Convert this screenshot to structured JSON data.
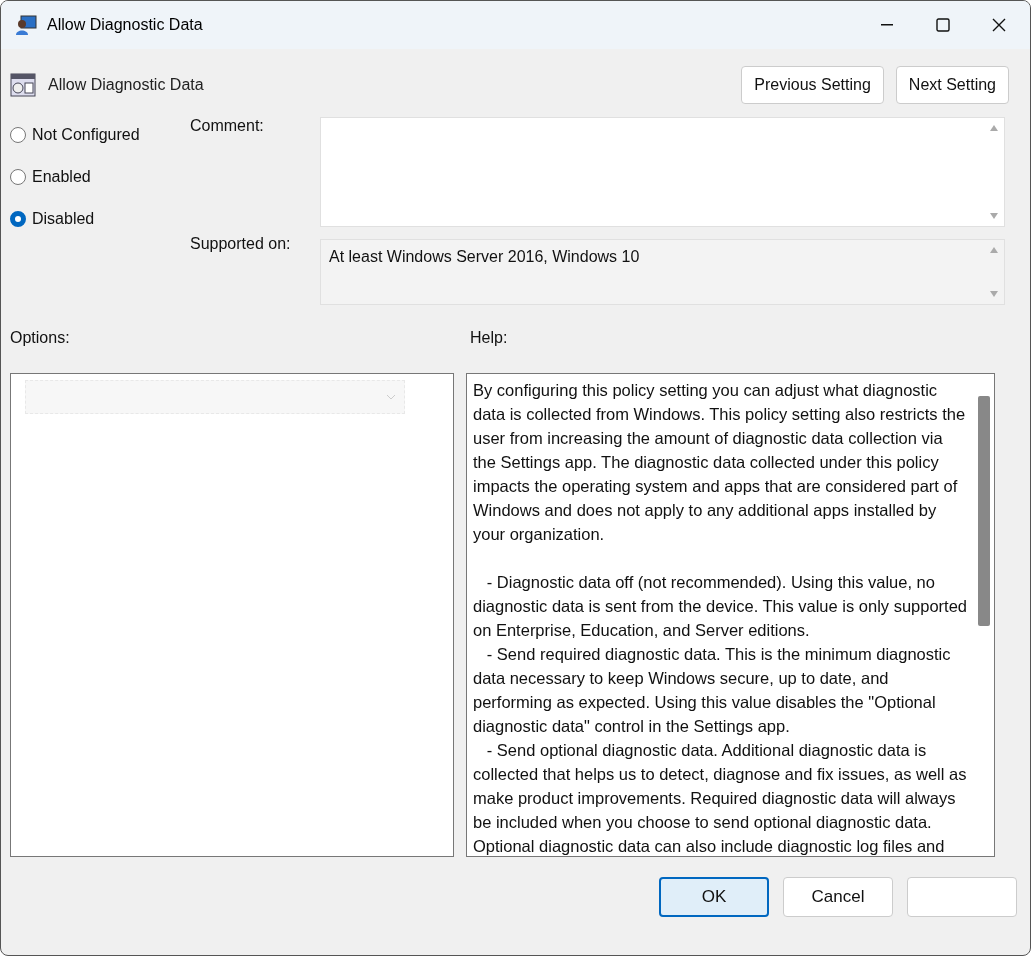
{
  "window": {
    "title": "Allow Diagnostic Data"
  },
  "policy": {
    "name": "Allow Diagnostic Data"
  },
  "nav_buttons": [
    "Previous Setting",
    "Next Setting"
  ],
  "states": [
    {
      "label": "Not Configured",
      "selected": false
    },
    {
      "label": "Enabled",
      "selected": false
    },
    {
      "label": "Disabled",
      "selected": true
    }
  ],
  "comment": {
    "label": "Comment:"
  },
  "supported_on": {
    "label": "Supported on:",
    "value": "At least Windows Server 2016, Windows 10"
  },
  "options": {
    "label": "Options:"
  },
  "help": {
    "label": "Help:",
    "paragraphs": [
      {
        "text": "By configuring this policy setting you can adjust what diagnostic data is collected from Windows. This policy setting also restricts the user from increasing the amount of diagnostic data collection via the Settings app. The diagnostic data collected under this policy impacts the operating system and apps that are considered part of Windows and does not apply to any additional apps installed by your organization.",
        "blank_line_before": false
      },
      {
        "text": "   - Diagnostic data off (not recommended). Using this value, no diagnostic data is sent from the device. This value is only supported on Enterprise, Education, and Server editions.",
        "blank_line_before": true
      },
      {
        "text": "   - Send required diagnostic data. This is the minimum diagnostic data necessary to keep Windows secure, up to date, and performing as expected. Using this value disables the \"Optional diagnostic data\" control in the Settings app.",
        "blank_line_before": false
      },
      {
        "text": "   - Send optional diagnostic data. Additional diagnostic data is collected that helps us to detect, diagnose and fix issues, as well as make product improvements. Required diagnostic data will always be included when you choose to send optional diagnostic data. Optional diagnostic data can also include diagnostic log files and",
        "blank_line_before": false
      }
    ]
  },
  "footer_buttons": [
    {
      "label": "OK",
      "selected": true
    },
    {
      "label": "Cancel",
      "selected": false
    },
    {
      "selected": false
    }
  ]
}
